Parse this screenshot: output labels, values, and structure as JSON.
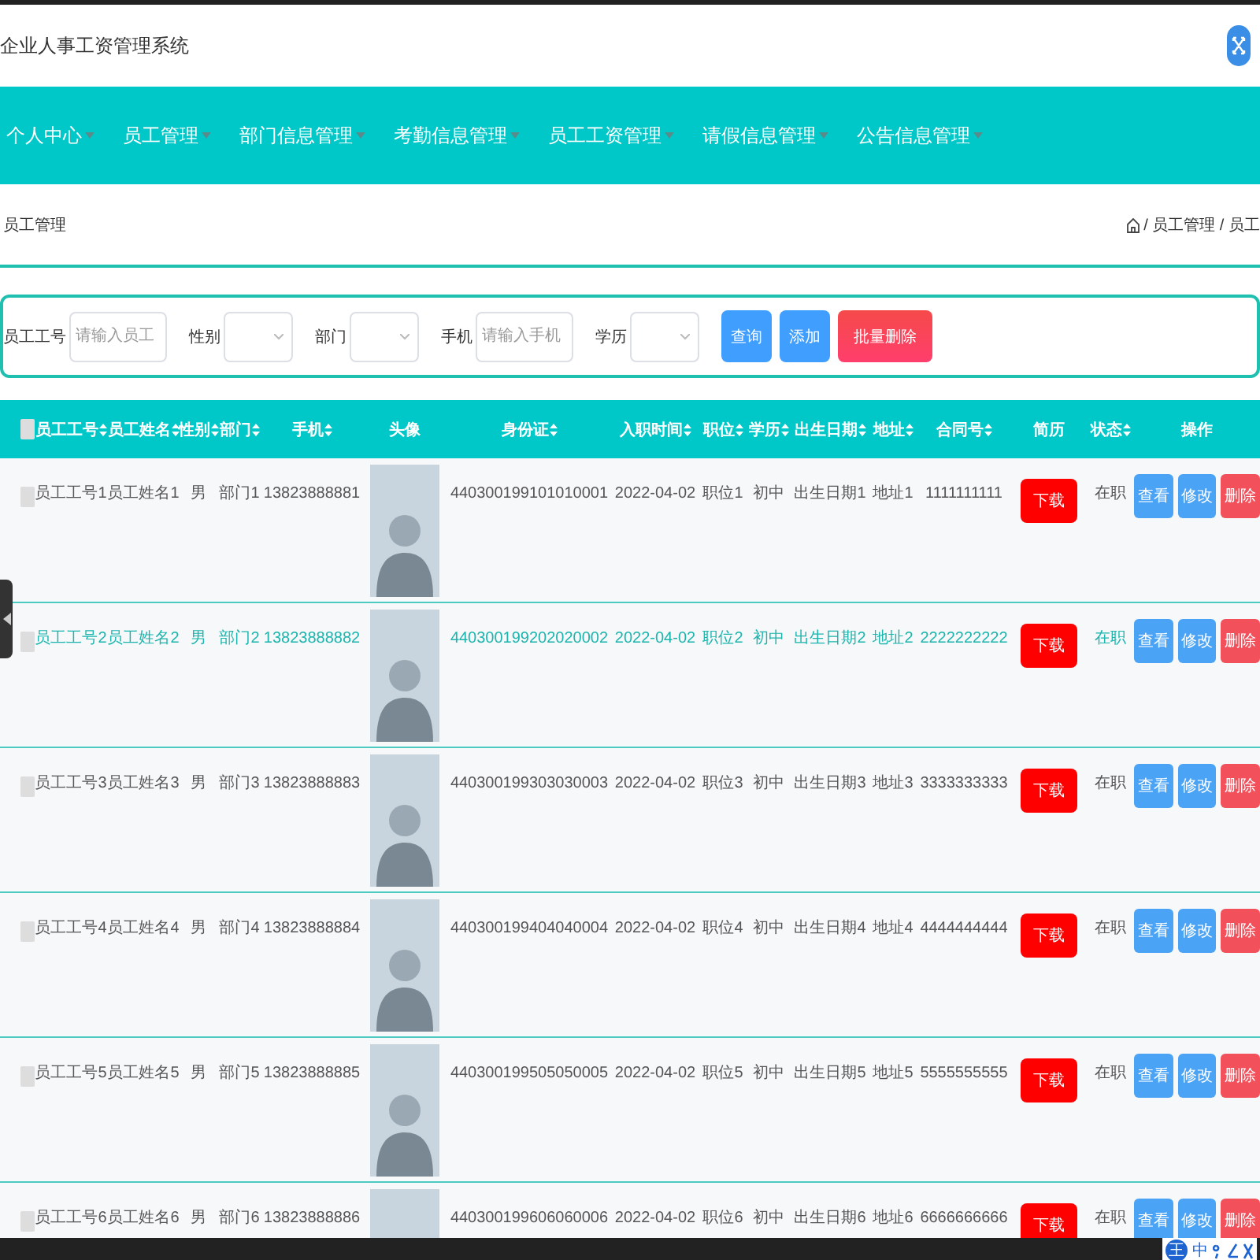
{
  "window": {
    "title": "企业人事工资管理系统"
  },
  "nav": [
    {
      "label": "个人中心"
    },
    {
      "label": "员工管理"
    },
    {
      "label": "部门信息管理"
    },
    {
      "label": "考勤信息管理"
    },
    {
      "label": "员工工资管理"
    },
    {
      "label": "请假信息管理"
    },
    {
      "label": "公告信息管理"
    }
  ],
  "page_title": "员工管理",
  "breadcrumb": [
    "/ 员工管理 / 员工"
  ],
  "filters": [
    {
      "kind": "input",
      "label": "员工工号",
      "placeholder": "请输入员工"
    },
    {
      "kind": "select",
      "label": "性别"
    },
    {
      "kind": "select",
      "label": "部门"
    },
    {
      "kind": "input",
      "label": "手机",
      "placeholder": "请输入手机"
    },
    {
      "kind": "select",
      "label": "学历"
    }
  ],
  "filter_buttons": [
    {
      "kind": "primary",
      "label": "查询"
    },
    {
      "kind": "primary",
      "label": "添加"
    },
    {
      "kind": "danger",
      "label": "批量删除"
    }
  ],
  "table": {
    "select_all_checked": false,
    "columns": [
      {
        "label": "员工工号",
        "sortable": true
      },
      {
        "label": "员工姓名",
        "sortable": true
      },
      {
        "label": "性别",
        "sortable": true
      },
      {
        "label": "部门",
        "sortable": true
      },
      {
        "label": "手机",
        "sortable": true
      },
      {
        "label": "头像",
        "sortable": false
      },
      {
        "label": "身份证",
        "sortable": true
      },
      {
        "label": "入职时间",
        "sortable": true
      },
      {
        "label": "职位",
        "sortable": true
      },
      {
        "label": "学历",
        "sortable": true
      },
      {
        "label": "出生日期",
        "sortable": true
      },
      {
        "label": "地址",
        "sortable": true
      },
      {
        "label": "合同号",
        "sortable": true
      },
      {
        "label": "简历",
        "sortable": false
      },
      {
        "label": "状态",
        "sortable": true
      },
      {
        "label": "操作",
        "sortable": false
      }
    ],
    "rows": [
      {
        "checked": false,
        "highlighted": false,
        "cells": [
          "员工工号1",
          "员工姓名1",
          "男",
          "部门1",
          "13823888881",
          "",
          "440300199101010001",
          "2022-04-02",
          "职位1",
          "初中",
          "出生日期1",
          "地址1",
          "1111111111"
        ],
        "resume": "下载",
        "status": "在职",
        "actions": [
          "查看",
          "修改",
          "删除"
        ]
      },
      {
        "checked": false,
        "highlighted": true,
        "cells": [
          "员工工号2",
          "员工姓名2",
          "男",
          "部门2",
          "13823888882",
          "",
          "440300199202020002",
          "2022-04-02",
          "职位2",
          "初中",
          "出生日期2",
          "地址2",
          "2222222222"
        ],
        "resume": "下载",
        "status": "在职",
        "actions": [
          "查看",
          "修改",
          "删除"
        ]
      },
      {
        "checked": false,
        "highlighted": false,
        "cells": [
          "员工工号3",
          "员工姓名3",
          "男",
          "部门3",
          "13823888883",
          "",
          "440300199303030003",
          "2022-04-02",
          "职位3",
          "初中",
          "出生日期3",
          "地址3",
          "3333333333"
        ],
        "resume": "下载",
        "status": "在职",
        "actions": [
          "查看",
          "修改",
          "删除"
        ]
      },
      {
        "checked": false,
        "highlighted": false,
        "cells": [
          "员工工号4",
          "员工姓名4",
          "男",
          "部门4",
          "13823888884",
          "",
          "440300199404040004",
          "2022-04-02",
          "职位4",
          "初中",
          "出生日期4",
          "地址4",
          "4444444444"
        ],
        "resume": "下载",
        "status": "在职",
        "actions": [
          "查看",
          "修改",
          "删除"
        ]
      },
      {
        "checked": false,
        "highlighted": false,
        "cells": [
          "员工工号5",
          "员工姓名5",
          "男",
          "部门5",
          "13823888885",
          "",
          "440300199505050005",
          "2022-04-02",
          "职位5",
          "初中",
          "出生日期5",
          "地址5",
          "5555555555"
        ],
        "resume": "下载",
        "status": "在职",
        "actions": [
          "查看",
          "修改",
          "删除"
        ]
      },
      {
        "checked": false,
        "highlighted": false,
        "cells": [
          "员工工号6",
          "员工姓名6",
          "男",
          "部门6",
          "13823888886",
          "",
          "440300199606060006",
          "2022-04-02",
          "职位6",
          "初中",
          "出生日期6",
          "地址6",
          "6666666666"
        ],
        "resume": "下载",
        "status": "在职",
        "actions": [
          "查看",
          "修改",
          "删除"
        ]
      }
    ]
  },
  "ime_toolbar": [
    "王",
    "中"
  ]
}
